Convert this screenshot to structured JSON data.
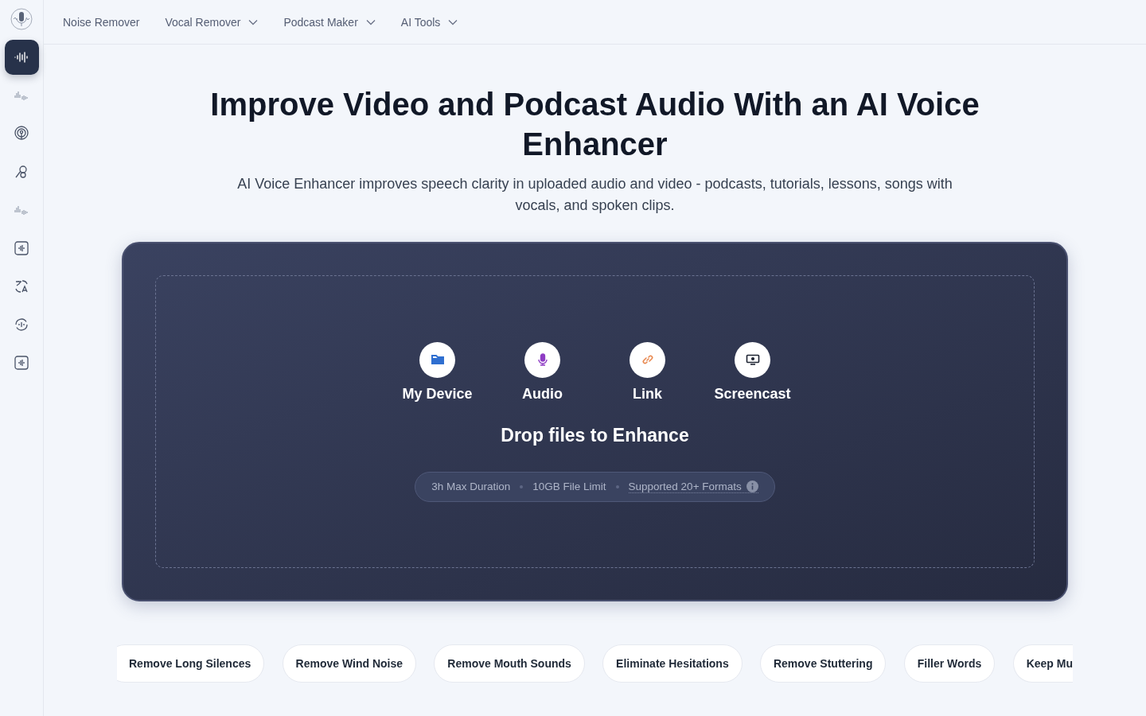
{
  "sidebar": {
    "items": [
      {
        "kind": "enhance",
        "selected": true
      },
      {
        "kind": "bars",
        "selected": false
      },
      {
        "kind": "podcast",
        "selected": false
      },
      {
        "kind": "mic",
        "selected": false
      },
      {
        "kind": "bars",
        "selected": false
      },
      {
        "kind": "wave",
        "selected": false
      },
      {
        "kind": "translate",
        "selected": false
      },
      {
        "kind": "cycle",
        "selected": false
      },
      {
        "kind": "wave",
        "selected": false
      }
    ]
  },
  "nav": [
    {
      "label": "Noise Remover",
      "dropdown": false
    },
    {
      "label": "Vocal Remover",
      "dropdown": true
    },
    {
      "label": "Podcast Maker",
      "dropdown": true
    },
    {
      "label": "AI Tools",
      "dropdown": true
    }
  ],
  "hero": {
    "title": "Improve Video and Podcast Audio With an AI Voice Enhancer",
    "subtitle": "AI Voice Enhancer improves speech clarity in uploaded audio and video - podcasts, tutorials, lessons, songs with vocals, and spoken clips."
  },
  "upload": {
    "sources": [
      {
        "kind": "folder",
        "label": "My Device",
        "color": "#2f6fd0"
      },
      {
        "kind": "mic",
        "label": "Audio",
        "color": "#8e3cc4"
      },
      {
        "kind": "link",
        "label": "Link",
        "color": "#e8884f"
      },
      {
        "kind": "screen",
        "label": "Screencast",
        "color": "#1e2433"
      }
    ],
    "drop_text": "Drop files to Enhance",
    "limits": [
      "3h Max Duration",
      "10GB File Limit",
      "Supported 20+ Formats"
    ]
  },
  "chips": [
    "Remove Long Silences",
    "Remove Wind Noise",
    "Remove Mouth Sounds",
    "Eliminate Hesitations",
    "Remove Stuttering",
    "Filler Words",
    "Keep Mu"
  ]
}
